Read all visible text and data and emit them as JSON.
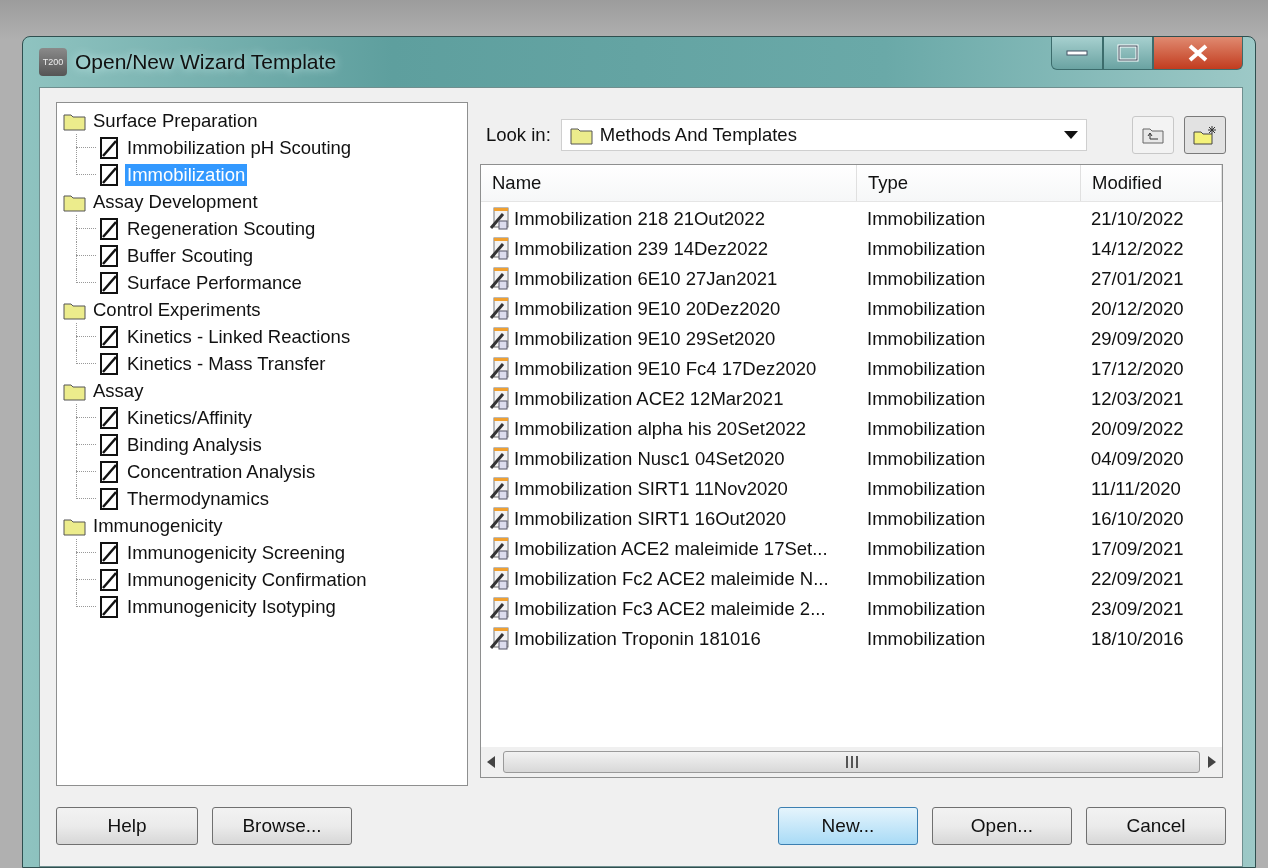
{
  "window": {
    "title": "Open/New Wizard Template",
    "app_badge": "T200"
  },
  "tree": [
    {
      "label": "Surface Preparation",
      "selected": false,
      "children": [
        {
          "label": "Immobilization pH Scouting",
          "selected": false
        },
        {
          "label": "Immobilization",
          "selected": true
        }
      ]
    },
    {
      "label": "Assay Development",
      "selected": false,
      "children": [
        {
          "label": "Regeneration Scouting",
          "selected": false
        },
        {
          "label": "Buffer Scouting",
          "selected": false
        },
        {
          "label": "Surface Performance",
          "selected": false
        }
      ]
    },
    {
      "label": "Control Experiments",
      "selected": false,
      "children": [
        {
          "label": "Kinetics - Linked Reactions",
          "selected": false
        },
        {
          "label": "Kinetics - Mass Transfer",
          "selected": false
        }
      ]
    },
    {
      "label": "Assay",
      "selected": false,
      "children": [
        {
          "label": "Kinetics/Affinity",
          "selected": false
        },
        {
          "label": "Binding Analysis",
          "selected": false
        },
        {
          "label": "Concentration Analysis",
          "selected": false
        },
        {
          "label": "Thermodynamics",
          "selected": false
        }
      ]
    },
    {
      "label": "Immunogenicity",
      "selected": false,
      "children": [
        {
          "label": "Immunogenicity Screening",
          "selected": false
        },
        {
          "label": "Immunogenicity Confirmation",
          "selected": false
        },
        {
          "label": "Immunogenicity Isotyping",
          "selected": false
        }
      ]
    }
  ],
  "look_in": {
    "label": "Look in:",
    "value": "Methods And Templates"
  },
  "file_list": {
    "columns": [
      "Name",
      "Type",
      "Modified"
    ],
    "rows": [
      {
        "name": "Immobilization 218 21Out2022",
        "type": "Immobilization",
        "modified": "21/10/2022"
      },
      {
        "name": "Immobilization 239 14Dez2022",
        "type": "Immobilization",
        "modified": "14/12/2022"
      },
      {
        "name": "Immobilization 6E10 27Jan2021",
        "type": "Immobilization",
        "modified": "27/01/2021"
      },
      {
        "name": "Immobilization 9E10 20Dez2020",
        "type": "Immobilization",
        "modified": "20/12/2020"
      },
      {
        "name": "Immobilization 9E10 29Set2020",
        "type": "Immobilization",
        "modified": "29/09/2020"
      },
      {
        "name": "Immobilization 9E10 Fc4 17Dez2020",
        "type": "Immobilization",
        "modified": "17/12/2020"
      },
      {
        "name": "Immobilization ACE2 12Mar2021",
        "type": "Immobilization",
        "modified": "12/03/2021"
      },
      {
        "name": "Immobilization alpha his 20Set2022",
        "type": "Immobilization",
        "modified": "20/09/2022"
      },
      {
        "name": "Immobilization Nusc1 04Set2020",
        "type": "Immobilization",
        "modified": "04/09/2020"
      },
      {
        "name": "Immobilization SIRT1 11Nov2020",
        "type": "Immobilization",
        "modified": "11/11/2020"
      },
      {
        "name": "Immobilization SIRT1 16Out2020",
        "type": "Immobilization",
        "modified": "16/10/2020"
      },
      {
        "name": "Imobilization ACE2 maleimide 17Set...",
        "type": "Immobilization",
        "modified": "17/09/2021"
      },
      {
        "name": "Imobilization Fc2 ACE2 maleimide N...",
        "type": "Immobilization",
        "modified": "22/09/2021"
      },
      {
        "name": "Imobilization Fc3 ACE2 maleimide 2...",
        "type": "Immobilization",
        "modified": "23/09/2021"
      },
      {
        "name": "Imobilization Troponin 181016",
        "type": "Immobilization",
        "modified": "18/10/2016"
      }
    ]
  },
  "buttons_left": [
    {
      "label": "Help",
      "default": false
    },
    {
      "label": "Browse...",
      "default": false
    }
  ],
  "buttons_right": [
    {
      "label": "New...",
      "default": true
    },
    {
      "label": "Open...",
      "default": false
    },
    {
      "label": "Cancel",
      "default": false
    }
  ]
}
